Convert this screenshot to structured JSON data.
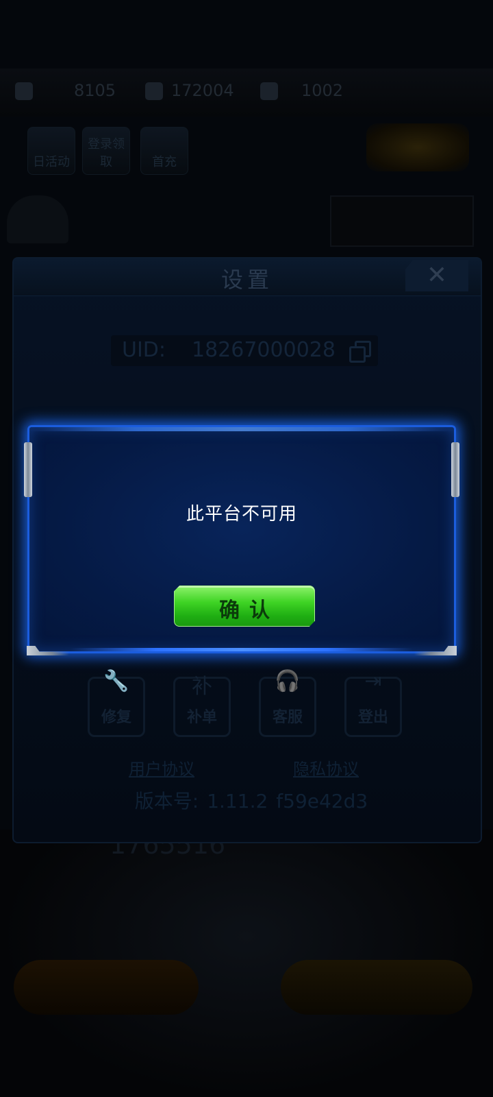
{
  "hud": {
    "resource_1": "8105",
    "resource_2": "172004",
    "resource_3": "1002"
  },
  "top_icons": [
    "日活动",
    "登录领取",
    "首充"
  ],
  "settings": {
    "title": "设置",
    "close_glyph": "✕",
    "uid_label": "UID:",
    "uid_value": "18267000028",
    "functions": [
      {
        "glyph": "🔧",
        "label": "修复"
      },
      {
        "glyph": "补",
        "label": "补单"
      },
      {
        "glyph": "🎧",
        "label": "客服"
      },
      {
        "glyph": "⇥",
        "label": "登出"
      }
    ],
    "link_user_agreement": "用户协议",
    "link_privacy": "隐私协议",
    "version_label": "版本号:",
    "version_number": "1.11.2",
    "version_hash": "f59e42d3"
  },
  "scene": {
    "power_value": "1765516"
  },
  "alert": {
    "message": "此平台不可用",
    "confirm_label": "确认"
  },
  "colors": {
    "alert_border": "#1b5dde",
    "alert_bg": "#051a45",
    "confirm_green": "#3fd425"
  }
}
